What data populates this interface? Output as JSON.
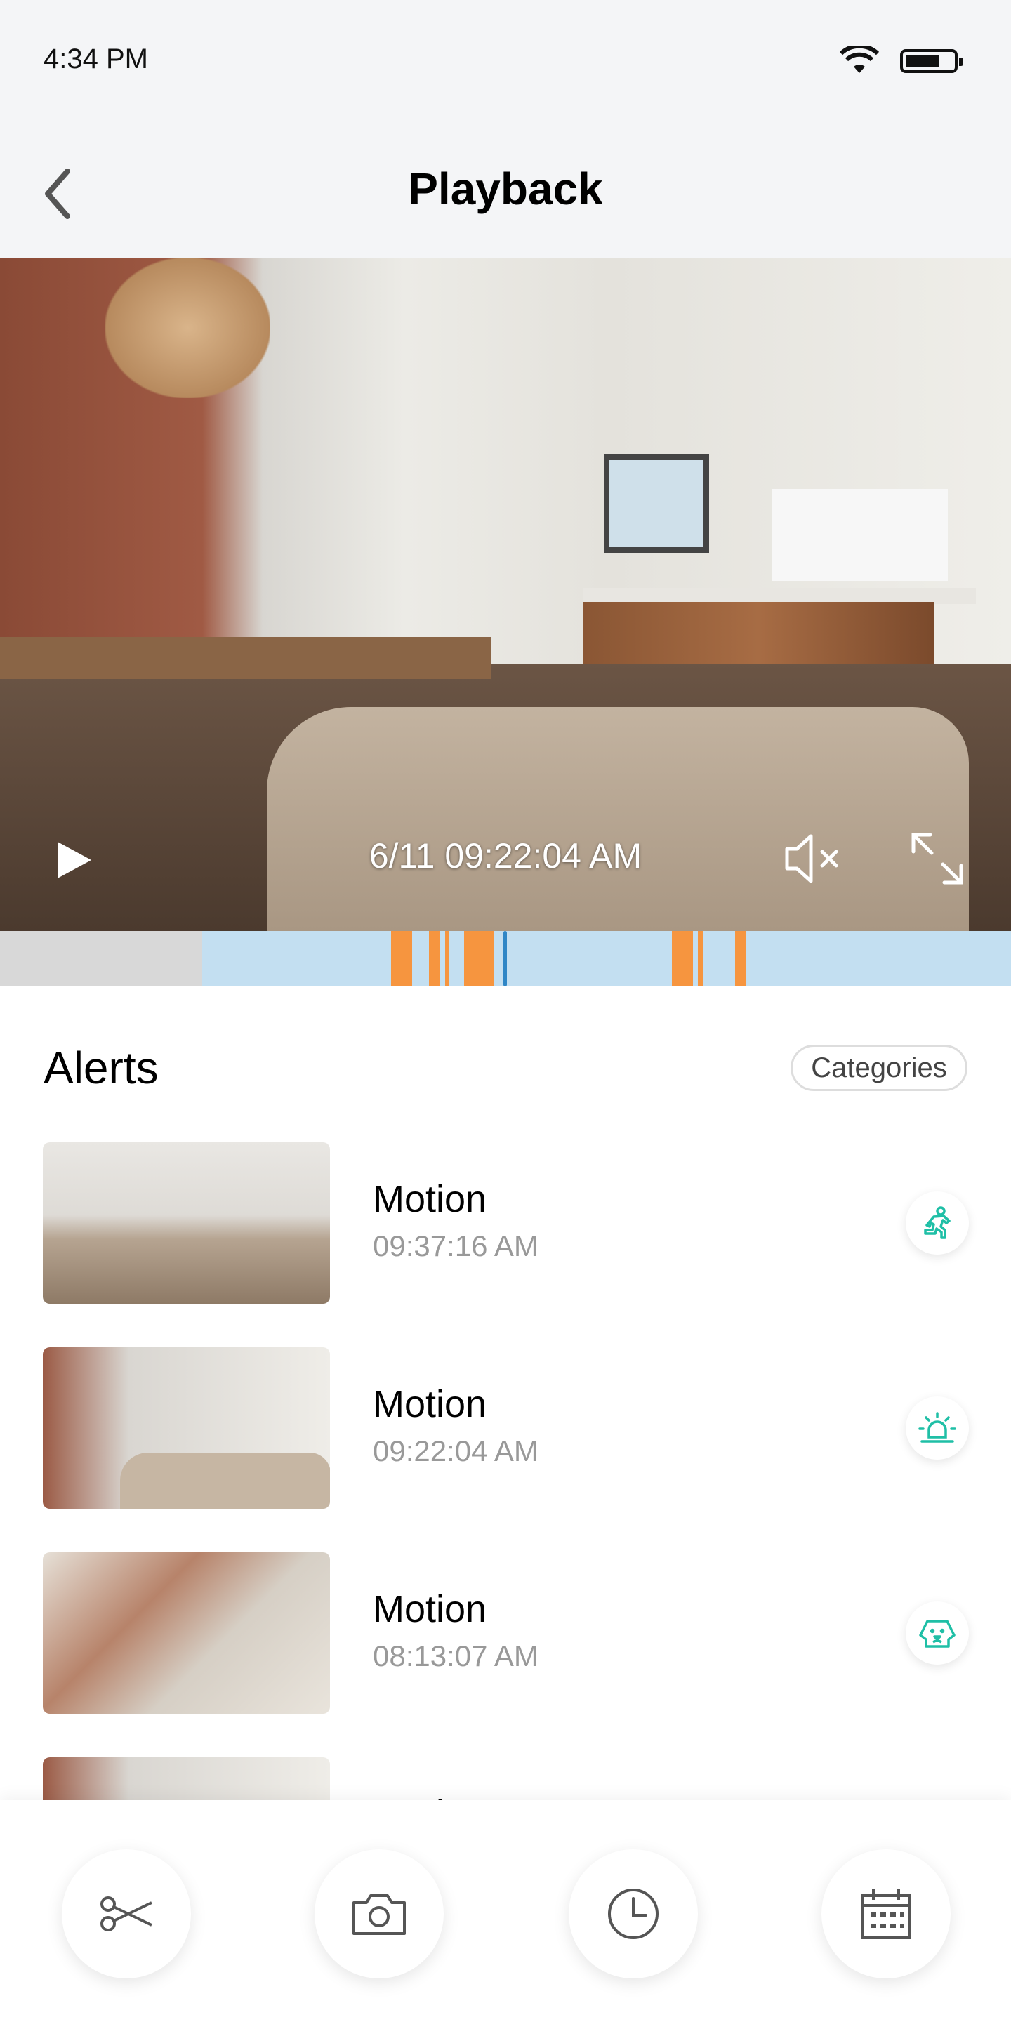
{
  "status_bar": {
    "time": "4:34 PM"
  },
  "header": {
    "title": "Playback"
  },
  "player": {
    "timestamp": "6/11 09:22:04 AM"
  },
  "colors": {
    "accent": "#1fbfa6",
    "event": "#f6953f",
    "timeline": "#c3dff1",
    "cursor": "#2f86c6"
  },
  "alerts": {
    "title": "Alerts",
    "categories_label": "Categories",
    "items": [
      {
        "title": "Motion",
        "time": "09:37:16 AM",
        "icon": "person-running-icon"
      },
      {
        "title": "Motion",
        "time": "09:22:04 AM",
        "icon": "siren-icon"
      },
      {
        "title": "Motion",
        "time": "08:13:07 AM",
        "icon": "dog-face-icon"
      },
      {
        "title": "Motion",
        "time": ""
      }
    ]
  },
  "toolbar": [
    "scissors-icon",
    "camera-icon",
    "clock-icon",
    "calendar-icon"
  ]
}
